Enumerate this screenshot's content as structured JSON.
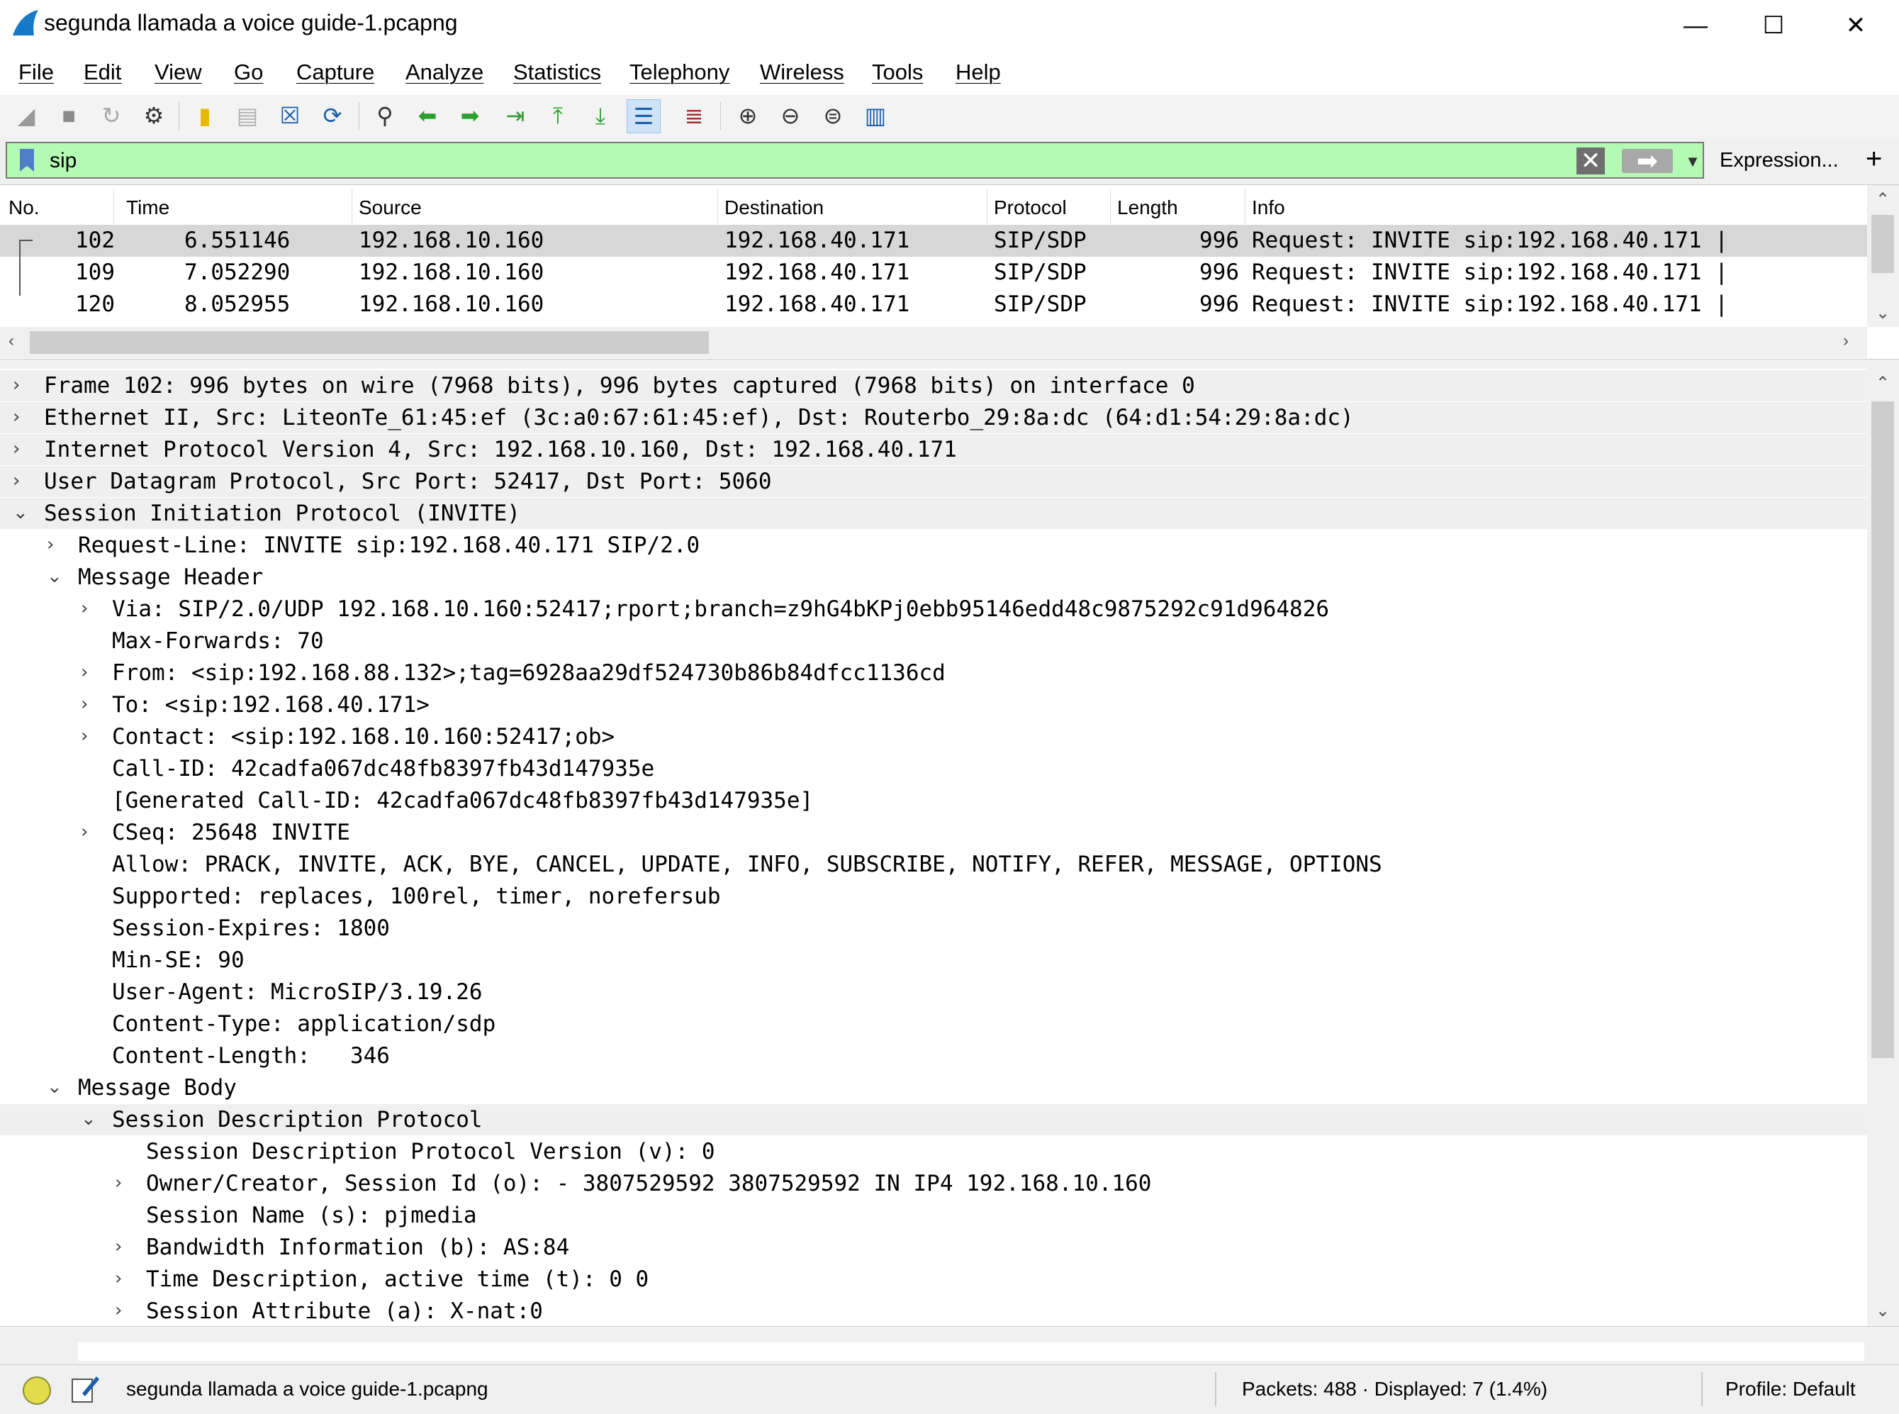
{
  "window": {
    "title": "segunda llamada a voice guide-1.pcapng",
    "app_icon": "wireshark-fin-icon",
    "controls": {
      "minimize": "—",
      "maximize": "☐",
      "close": "✕"
    }
  },
  "menu": [
    "File",
    "Edit",
    "View",
    "Go",
    "Capture",
    "Analyze",
    "Statistics",
    "Telephony",
    "Wireless",
    "Tools",
    "Help"
  ],
  "toolbar": {
    "icons": [
      "start-capture-icon",
      "stop-capture-icon",
      "restart-capture-icon",
      "capture-options-icon",
      "open-file-icon",
      "save-file-icon",
      "close-file-icon",
      "reload-file-icon",
      "find-packet-icon",
      "go-back-icon",
      "go-forward-icon",
      "go-to-packet-icon",
      "first-packet-icon",
      "last-packet-icon",
      "autoscroll-icon",
      "colorize-icon",
      "zoom-in-icon",
      "zoom-out-icon",
      "normal-size-icon",
      "resize-columns-icon"
    ]
  },
  "filter": {
    "value": "sip",
    "expression_label": "Expression...",
    "add_label": "+",
    "color": "#b4fab4"
  },
  "packet_list": {
    "columns": [
      "No.",
      "Time",
      "Source",
      "Destination",
      "Protocol",
      "Length",
      "Info"
    ],
    "rows": [
      {
        "no": "102",
        "time": "6.551146",
        "source": "192.168.10.160",
        "destination": "192.168.40.171",
        "protocol": "SIP/SDP",
        "length": "996",
        "info": "Request: INVITE sip:192.168.40.171 |"
      },
      {
        "no": "109",
        "time": "7.052290",
        "source": "192.168.10.160",
        "destination": "192.168.40.171",
        "protocol": "SIP/SDP",
        "length": "996",
        "info": "Request: INVITE sip:192.168.40.171 |"
      },
      {
        "no": "120",
        "time": "8.052955",
        "source": "192.168.10.160",
        "destination": "192.168.40.171",
        "protocol": "SIP/SDP",
        "length": "996",
        "info": "Request: INVITE sip:192.168.40.171 |"
      }
    ],
    "selected_color": "#d7d7d7"
  },
  "details": {
    "lines": [
      {
        "text": "Frame 102: 996 bytes on wire (7968 bits), 996 bytes captured (7968 bits) on interface 0",
        "exp": "›"
      },
      {
        "text": "Ethernet II, Src: LiteonTe_61:45:ef (3c:a0:67:61:45:ef), Dst: Routerbo_29:8a:dc (64:d1:54:29:8a:dc)",
        "exp": "›"
      },
      {
        "text": "Internet Protocol Version 4, Src: 192.168.10.160, Dst: 192.168.40.171",
        "exp": "›"
      },
      {
        "text": "User Datagram Protocol, Src Port: 52417, Dst Port: 5060",
        "exp": "›"
      },
      {
        "text": "Session Initiation Protocol (INVITE)",
        "exp": "⌄"
      },
      {
        "text": "Request-Line: INVITE sip:192.168.40.171 SIP/2.0",
        "exp": "›"
      },
      {
        "text": "Message Header",
        "exp": "⌄"
      },
      {
        "text": "Via: SIP/2.0/UDP 192.168.10.160:52417;rport;branch=z9hG4bKPj0ebb95146edd48c9875292c91d964826",
        "exp": "›"
      },
      {
        "text": "Max-Forwards: 70",
        "exp": ""
      },
      {
        "text": "From: <sip:192.168.88.132>;tag=6928aa29df524730b86b84dfcc1136cd",
        "exp": "›"
      },
      {
        "text": "To: <sip:192.168.40.171>",
        "exp": "›"
      },
      {
        "text": "Contact: <sip:192.168.10.160:52417;ob>",
        "exp": "›"
      },
      {
        "text": "Call-ID: 42cadfa067dc48fb8397fb43d147935e",
        "exp": ""
      },
      {
        "text": "[Generated Call-ID: 42cadfa067dc48fb8397fb43d147935e]",
        "exp": ""
      },
      {
        "text": "CSeq: 25648 INVITE",
        "exp": "›"
      },
      {
        "text": "Allow: PRACK, INVITE, ACK, BYE, CANCEL, UPDATE, INFO, SUBSCRIBE, NOTIFY, REFER, MESSAGE, OPTIONS",
        "exp": ""
      },
      {
        "text": "Supported: replaces, 100rel, timer, norefersub",
        "exp": ""
      },
      {
        "text": "Session-Expires: 1800",
        "exp": ""
      },
      {
        "text": "Min-SE: 90",
        "exp": ""
      },
      {
        "text": "User-Agent: MicroSIP/3.19.26",
        "exp": ""
      },
      {
        "text": "Content-Type: application/sdp",
        "exp": ""
      },
      {
        "text": "Content-Length:   346",
        "exp": ""
      },
      {
        "text": "Message Body",
        "exp": "⌄"
      },
      {
        "text": "Session Description Protocol",
        "exp": "⌄"
      },
      {
        "text": "Session Description Protocol Version (v): 0",
        "exp": ""
      },
      {
        "text": "Owner/Creator, Session Id (o): - 3807529592 3807529592 IN IP4 192.168.10.160",
        "exp": "›"
      },
      {
        "text": "Session Name (s): pjmedia",
        "exp": ""
      },
      {
        "text": "Bandwidth Information (b): AS:84",
        "exp": "›"
      },
      {
        "text": "Time Description, active time (t): 0 0",
        "exp": "›"
      },
      {
        "text": "Session Attribute (a): X-nat:0",
        "exp": "›"
      }
    ],
    "highlight_color": "#efefef"
  },
  "status": {
    "file": "segunda llamada a voice guide-1.pcapng",
    "packets": "Packets: 488 · Displayed: 7 (1.4%)",
    "profile": "Profile: Default",
    "ready_icon": "ready-status-icon",
    "comment_icon": "edit-comment-icon"
  }
}
